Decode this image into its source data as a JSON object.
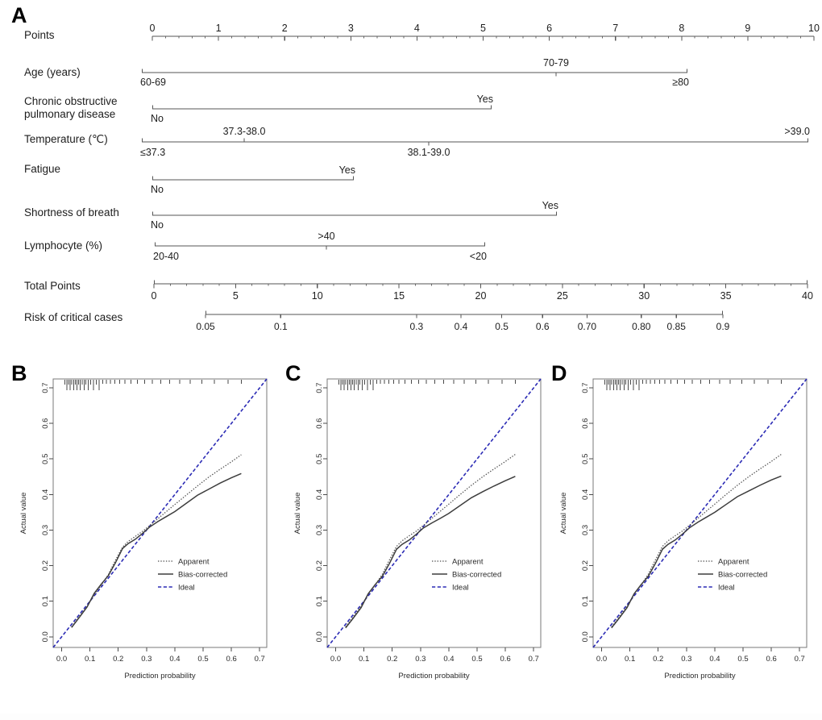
{
  "figure": {
    "panels": [
      "A",
      "B",
      "C",
      "D"
    ]
  },
  "nomogram": {
    "rows": [
      {
        "label": "Points",
        "kind": "scale"
      },
      {
        "label": "Age (years)",
        "kind": "factor"
      },
      {
        "label": "Chronic obstructive\npulmonary disease",
        "kind": "factor"
      },
      {
        "label": "Temperature (℃)",
        "kind": "factor"
      },
      {
        "label": "Fatigue",
        "kind": "factor"
      },
      {
        "label": "Shortness of breath",
        "kind": "factor"
      },
      {
        "label": "Lymphocyte (%)",
        "kind": "factor"
      },
      {
        "label": "Total Points",
        "kind": "scale"
      },
      {
        "label": "Risk of critical cases",
        "kind": "scale"
      }
    ],
    "points_axis": {
      "ticks": [
        "0",
        "1",
        "2",
        "3",
        "4",
        "5",
        "6",
        "7",
        "8",
        "9",
        "10"
      ]
    },
    "total_points_axis": {
      "ticks": [
        "0",
        "5",
        "10",
        "15",
        "20",
        "25",
        "30",
        "35",
        "40"
      ]
    },
    "risk_axis": {
      "ticks": [
        "0.05",
        "0.1",
        "0.3",
        "0.4",
        "0.5",
        "0.6",
        "0.70",
        "0.80",
        "0.85",
        "0.9"
      ]
    },
    "age": {
      "levels": [
        "60-69",
        "70-79",
        "≥80"
      ]
    },
    "copd": {
      "levels": [
        "No",
        "Yes"
      ]
    },
    "temperature": {
      "levels": [
        "≤37.3",
        "37.3-38.0",
        "38.1-39.0",
        ">39.0"
      ]
    },
    "fatigue": {
      "levels": [
        "No",
        "Yes"
      ]
    },
    "shortness": {
      "levels": [
        "No",
        "Yes"
      ]
    },
    "lymphocyte": {
      "levels": [
        "20-40",
        ">40",
        "<20"
      ]
    }
  },
  "calibration": {
    "xlabel": "Prediction probability",
    "ylabel": "Actual value",
    "xticks": [
      "0.0",
      "0.1",
      "0.2",
      "0.3",
      "0.4",
      "0.5",
      "0.6",
      "0.7"
    ],
    "yticks": [
      "0.0",
      "0.1",
      "0.2",
      "0.3",
      "0.4",
      "0.5",
      "0.6",
      "0.7"
    ],
    "legend": [
      "Apparent",
      "Bias-corrected",
      "Ideal"
    ],
    "colors": {
      "ideal": "#2b2bb5",
      "apparent": "#4d4d4d",
      "bias": "#3d3d3d"
    }
  },
  "chart_data": [
    {
      "type": "line",
      "panel": "B",
      "title": "",
      "xlabel": "Prediction probability",
      "ylabel": "Actual value",
      "xlim": [
        -0.03,
        0.725
      ],
      "ylim": [
        -0.03,
        0.725
      ],
      "grid": false,
      "legend_position": "center-right",
      "series": [
        {
          "name": "Apparent",
          "style": "dotted",
          "x": [
            0.035,
            0.06,
            0.09,
            0.115,
            0.14,
            0.165,
            0.19,
            0.215,
            0.235,
            0.26,
            0.285,
            0.31,
            0.34,
            0.37,
            0.4,
            0.44,
            0.48,
            0.52,
            0.56,
            0.6,
            0.635
          ],
          "y": [
            0.028,
            0.055,
            0.085,
            0.118,
            0.145,
            0.175,
            0.215,
            0.252,
            0.268,
            0.282,
            0.296,
            0.312,
            0.332,
            0.352,
            0.372,
            0.398,
            0.424,
            0.449,
            0.471,
            0.492,
            0.512
          ]
        },
        {
          "name": "Bias-corrected",
          "style": "solid",
          "x": [
            0.035,
            0.06,
            0.09,
            0.115,
            0.14,
            0.165,
            0.19,
            0.215,
            0.235,
            0.26,
            0.285,
            0.31,
            0.34,
            0.37,
            0.4,
            0.44,
            0.48,
            0.52,
            0.56,
            0.6,
            0.635
          ],
          "y": [
            0.026,
            0.052,
            0.084,
            0.122,
            0.148,
            0.172,
            0.208,
            0.248,
            0.262,
            0.274,
            0.29,
            0.308,
            0.324,
            0.338,
            0.352,
            0.375,
            0.398,
            0.415,
            0.432,
            0.447,
            0.459
          ]
        },
        {
          "name": "Ideal",
          "style": "dashed",
          "x": [
            -0.03,
            0.725
          ],
          "y": [
            -0.03,
            0.725
          ]
        }
      ],
      "rug_x": [
        0.012,
        0.018,
        0.024,
        0.03,
        0.036,
        0.042,
        0.048,
        0.054,
        0.06,
        0.066,
        0.072,
        0.079,
        0.086,
        0.094,
        0.102,
        0.112,
        0.122,
        0.133,
        0.145,
        0.158,
        0.172,
        0.188,
        0.205,
        0.224,
        0.245,
        0.268,
        0.293,
        0.32,
        0.35,
        0.382,
        0.417,
        0.455,
        0.496,
        0.54,
        0.588,
        0.635
      ]
    },
    {
      "type": "line",
      "panel": "C",
      "title": "",
      "xlabel": "Prediction probability",
      "ylabel": "Actual value",
      "xlim": [
        -0.03,
        0.725
      ],
      "ylim": [
        -0.03,
        0.725
      ],
      "grid": false,
      "legend_position": "center-right",
      "series": [
        {
          "name": "Apparent",
          "style": "dotted",
          "x": [
            0.035,
            0.06,
            0.09,
            0.115,
            0.14,
            0.165,
            0.19,
            0.215,
            0.235,
            0.26,
            0.285,
            0.31,
            0.34,
            0.37,
            0.4,
            0.44,
            0.48,
            0.52,
            0.56,
            0.6,
            0.635
          ],
          "y": [
            0.028,
            0.054,
            0.086,
            0.12,
            0.146,
            0.176,
            0.216,
            0.254,
            0.27,
            0.284,
            0.297,
            0.313,
            0.333,
            0.353,
            0.373,
            0.4,
            0.426,
            0.45,
            0.472,
            0.493,
            0.513
          ]
        },
        {
          "name": "Bias-corrected",
          "style": "solid",
          "x": [
            0.035,
            0.06,
            0.09,
            0.115,
            0.14,
            0.165,
            0.19,
            0.215,
            0.235,
            0.26,
            0.285,
            0.31,
            0.34,
            0.37,
            0.4,
            0.44,
            0.48,
            0.52,
            0.56,
            0.6,
            0.635
          ],
          "y": [
            0.025,
            0.05,
            0.082,
            0.121,
            0.147,
            0.17,
            0.206,
            0.246,
            0.26,
            0.272,
            0.288,
            0.306,
            0.32,
            0.333,
            0.347,
            0.369,
            0.391,
            0.408,
            0.424,
            0.439,
            0.451
          ]
        },
        {
          "name": "Ideal",
          "style": "dashed",
          "x": [
            -0.03,
            0.725
          ],
          "y": [
            -0.03,
            0.725
          ]
        }
      ],
      "rug_x": [
        0.012,
        0.018,
        0.024,
        0.03,
        0.036,
        0.042,
        0.048,
        0.054,
        0.06,
        0.066,
        0.072,
        0.079,
        0.086,
        0.094,
        0.102,
        0.112,
        0.122,
        0.133,
        0.145,
        0.158,
        0.172,
        0.188,
        0.205,
        0.224,
        0.245,
        0.268,
        0.293,
        0.32,
        0.35,
        0.382,
        0.417,
        0.455,
        0.496,
        0.54,
        0.588,
        0.635
      ]
    },
    {
      "type": "line",
      "panel": "D",
      "title": "",
      "xlabel": "Prediction probability",
      "ylabel": "Actual value",
      "xlim": [
        -0.03,
        0.725
      ],
      "ylim": [
        -0.03,
        0.725
      ],
      "grid": false,
      "legend_position": "center-right",
      "series": [
        {
          "name": "Apparent",
          "style": "dotted",
          "x": [
            0.035,
            0.06,
            0.09,
            0.115,
            0.14,
            0.165,
            0.19,
            0.215,
            0.235,
            0.26,
            0.285,
            0.31,
            0.34,
            0.37,
            0.4,
            0.44,
            0.48,
            0.52,
            0.56,
            0.6,
            0.635
          ],
          "y": [
            0.028,
            0.054,
            0.086,
            0.12,
            0.146,
            0.176,
            0.216,
            0.254,
            0.27,
            0.284,
            0.297,
            0.313,
            0.333,
            0.353,
            0.373,
            0.4,
            0.426,
            0.45,
            0.472,
            0.493,
            0.513
          ]
        },
        {
          "name": "Bias-corrected",
          "style": "solid",
          "x": [
            0.035,
            0.06,
            0.09,
            0.115,
            0.14,
            0.165,
            0.19,
            0.215,
            0.235,
            0.26,
            0.285,
            0.31,
            0.34,
            0.37,
            0.4,
            0.44,
            0.48,
            0.52,
            0.56,
            0.6,
            0.635
          ],
          "y": [
            0.025,
            0.05,
            0.082,
            0.121,
            0.147,
            0.17,
            0.206,
            0.246,
            0.26,
            0.272,
            0.288,
            0.306,
            0.322,
            0.336,
            0.35,
            0.372,
            0.394,
            0.41,
            0.426,
            0.441,
            0.452
          ]
        },
        {
          "name": "Ideal",
          "style": "dashed",
          "x": [
            -0.03,
            0.725
          ],
          "y": [
            -0.03,
            0.725
          ]
        }
      ],
      "rug_x": [
        0.012,
        0.018,
        0.024,
        0.03,
        0.036,
        0.042,
        0.048,
        0.054,
        0.06,
        0.066,
        0.072,
        0.079,
        0.086,
        0.094,
        0.102,
        0.112,
        0.122,
        0.133,
        0.145,
        0.158,
        0.172,
        0.188,
        0.205,
        0.224,
        0.245,
        0.268,
        0.293,
        0.32,
        0.35,
        0.382,
        0.417,
        0.455,
        0.496,
        0.54,
        0.588,
        0.635
      ]
    }
  ]
}
